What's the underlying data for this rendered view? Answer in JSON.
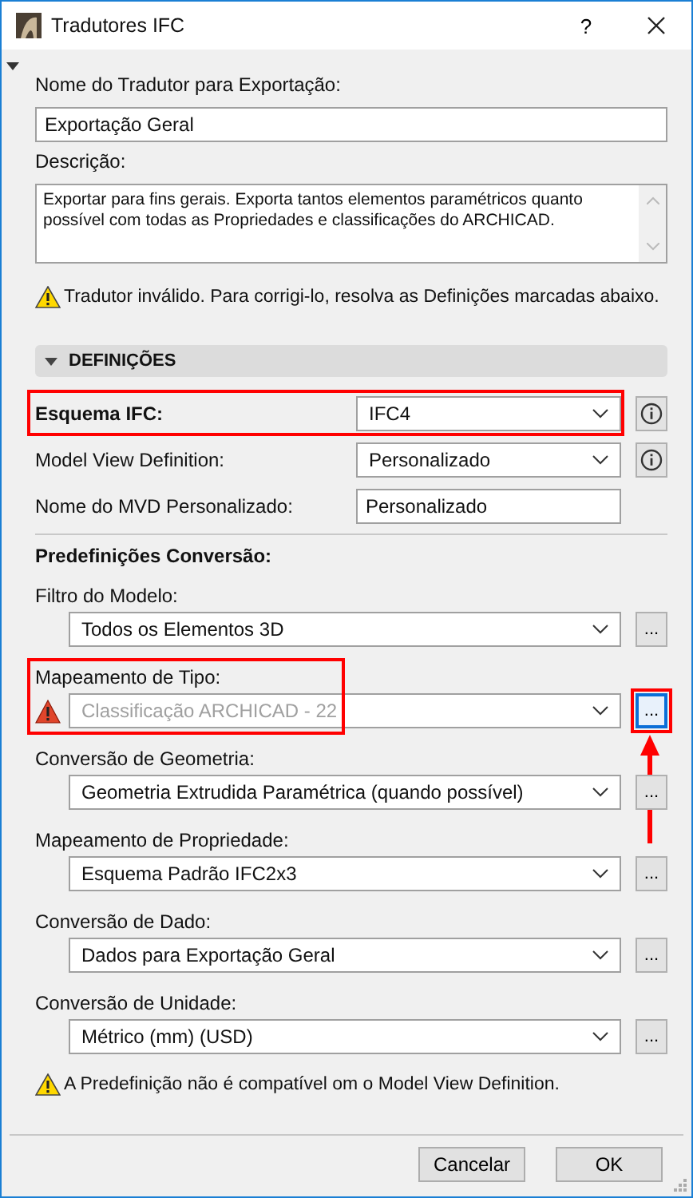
{
  "window": {
    "title": "Tradutores IFC",
    "help": "?"
  },
  "name_field": {
    "label": "Nome do Tradutor para Exportação:",
    "value": "Exportação Geral"
  },
  "description_field": {
    "label": "Descrição:",
    "value": "Exportar para fins gerais. Exporta tantos elementos paramétricos quanto possível com todas as Propriedades e classificações do ARCHICAD."
  },
  "translator_warning": "Tradutor inválido. Para corrigi-lo, resolva as Definições marcadas abaixo.",
  "section": {
    "title": "DEFINIÇÕES",
    "expanded": true
  },
  "settings": [
    {
      "kind": "select",
      "label": "Esquema IFC:",
      "value": "IFC4",
      "bold": true,
      "highlighted": true
    },
    {
      "kind": "select",
      "label": "Model View Definition:",
      "value": "Personalizado",
      "bold": false,
      "highlighted": false
    },
    {
      "kind": "input",
      "label": "Nome do MVD Personalizado:",
      "value": "Personalizado",
      "bold": false,
      "highlighted": false
    }
  ],
  "presets_title": "Predefinições Conversão:",
  "presets": [
    {
      "label": "Filtro do Modelo:",
      "value": "Todos os Elementos 3D",
      "disabled": false,
      "warning": false,
      "highlighted": false,
      "button": "...",
      "button_highlighted": false
    },
    {
      "label": "Mapeamento de Tipo:",
      "value": "Classificação ARCHICAD - 22",
      "disabled": true,
      "warning": true,
      "highlighted": true,
      "button": "...",
      "button_highlighted": true
    },
    {
      "label": "Conversão de Geometria:",
      "value": "Geometria Extrudida Paramétrica (quando possível)",
      "disabled": false,
      "warning": false,
      "highlighted": false,
      "button": "...",
      "button_highlighted": false
    },
    {
      "label": "Mapeamento de Propriedade:",
      "value": "Esquema Padrão IFC2x3",
      "disabled": false,
      "warning": false,
      "highlighted": false,
      "button": "...",
      "button_highlighted": false
    },
    {
      "label": "Conversão de Dado:",
      "value": "Dados para Exportação Geral",
      "disabled": false,
      "warning": false,
      "highlighted": false,
      "button": "...",
      "button_highlighted": false
    },
    {
      "label": "Conversão de Unidade:",
      "value": "Métrico (mm) (USD)",
      "disabled": false,
      "warning": false,
      "highlighted": false,
      "button": "...",
      "button_highlighted": false
    }
  ],
  "presets_warning": "A Predefinição não é compatível om o Model View Definition.",
  "buttons": [
    "Cancelar",
    "OK"
  ]
}
